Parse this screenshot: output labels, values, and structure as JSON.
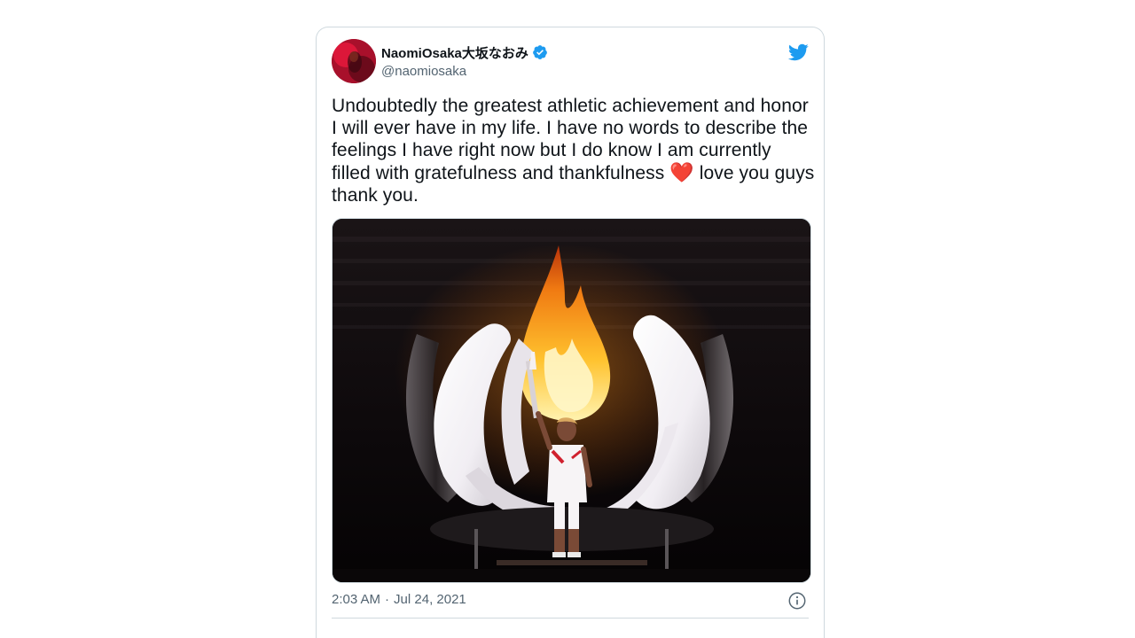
{
  "tweet": {
    "author": {
      "display_name": "NaomiOsaka大坂なおみ",
      "handle": "@naomiosaka",
      "verified": true
    },
    "text_before_emoji": "Undoubtedly the greatest athletic achievement and honor I will ever have in my life. I have no words to describe the feelings I have right now but I do know I am currently filled with gratefulness and thankfulness ",
    "emoji": "❤️",
    "text_after_emoji": " love you guys thank you.",
    "time": "2:03 AM",
    "separator": "·",
    "date": "Jul 24, 2021"
  },
  "icons": {
    "brand": "twitter-bird-icon",
    "verified": "verified-badge-icon",
    "info": "info-icon"
  },
  "colors": {
    "brand_blue": "#1d9bf0",
    "text_primary": "#0f1419",
    "text_secondary": "#536471",
    "border": "#cfd9de",
    "heart": "#e0245e"
  }
}
